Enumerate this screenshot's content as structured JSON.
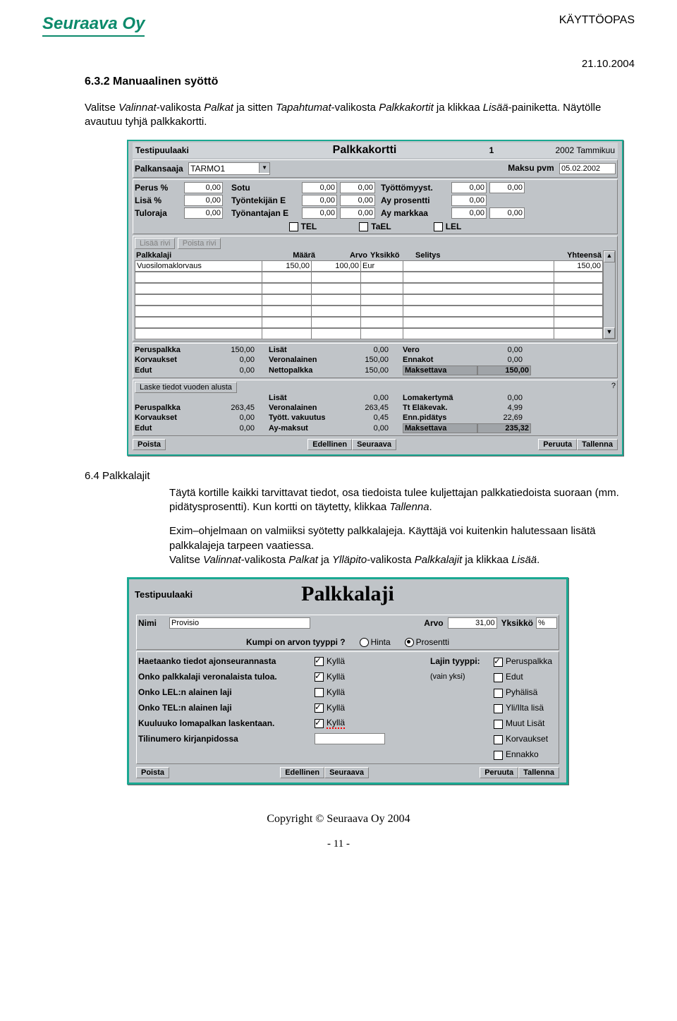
{
  "header": {
    "logo": "Seuraava Oy",
    "doc_type": "KÄYTTÖOPAS",
    "date": "21.10.2004"
  },
  "sec632": {
    "heading": "6.3.2 Manuaalinen syöttö",
    "para": "Valitse Valinnat-valikosta Palkat ja sitten Tapahtumat-valikosta Palkkakortit ja klikkaa Lisää-painiketta. Näytölle avautuu tyhjä palkkakortti."
  },
  "palkkakortti": {
    "company": "Testipuulaaki",
    "title": "Palkkakortti",
    "num": "1",
    "period": "2002 Tammikuu",
    "saaja_lbl": "Palkansaaja",
    "saaja_val": "TARMO1",
    "maksu_lbl": "Maksu pvm",
    "maksu_val": "05.02.2002",
    "top_rows": [
      {
        "l": "Perus %",
        "v1": "0,00",
        "c": "Sotu",
        "v2": "0,00",
        "v3": "0,00",
        "r": "Työttömyyst.",
        "v4": "0,00",
        "v5": "0,00"
      },
      {
        "l": "Lisä %",
        "v1": "0,00",
        "c": "Työntekijän E",
        "v2": "0,00",
        "v3": "0,00",
        "r": "Ay prosentti",
        "v4": "0,00",
        "v5": ""
      },
      {
        "l": "Tuloraja",
        "v1": "0,00",
        "c": "Työnantajan E",
        "v2": "0,00",
        "v3": "0,00",
        "r": "Ay markkaa",
        "v4": "0,00",
        "v5": "0,00"
      }
    ],
    "chk_tel": "TEL",
    "chk_tael": "TaEL",
    "chk_lel": "LEL",
    "btn_lisaa": "Lisää rivi",
    "btn_poista": "Poista rivi",
    "grid_headers": [
      "Palkkalaji",
      "Määrä",
      "Arvo",
      "Yksikkö",
      "Selitys",
      "Yhteensä"
    ],
    "grid_row": {
      "laji": "Vuosilomaklorvaus",
      "maara": "150,00",
      "arvo": "100,00",
      "yks": "Eur",
      "sel": "",
      "yht": "150,00"
    },
    "sum1": [
      [
        "Peruspalkka",
        "150,00",
        "Lisät",
        "0,00",
        "Vero",
        "0,00"
      ],
      [
        "Korvaukset",
        "0,00",
        "Veronalainen",
        "150,00",
        "Ennakot",
        "0,00"
      ],
      [
        "Edut",
        "0,00",
        "Nettopalkka",
        "150,00",
        "Maksettava",
        "150,00"
      ]
    ],
    "btn_laske": "Laske tiedot vuoden alusta",
    "sum2": [
      [
        "",
        "",
        "Lisät",
        "0,00",
        "Lomakertymä",
        "0,00"
      ],
      [
        "Peruspalkka",
        "263,45",
        "Veronalainen",
        "263,45",
        "Tt Eläkevak.",
        "4,99"
      ],
      [
        "Korvaukset",
        "0,00",
        "Tyött. vakuutus",
        "0,45",
        "Enn.pidätys",
        "22,69"
      ],
      [
        "Edut",
        "0,00",
        "Ay-maksut",
        "0,00",
        "Maksettava",
        "235,32"
      ]
    ],
    "btn_bottom": {
      "poista": "Poista",
      "edell": "Edellinen",
      "seur": "Seuraava",
      "peruuta": "Peruuta",
      "tall": "Tallenna"
    }
  },
  "sec64_label": "6.4 Palkkalajit",
  "sec64_para1": "Täytä kortille kaikki tarvittavat tiedot, osa tiedoista tulee kuljettajan palkkatiedoista suoraan (mm. pidätysprosentti). Kun kortti on täytetty, klikkaa Tallenna.",
  "sec64_para2": "Exim–ohjelmaan on valmiiksi syötetty palkkalajeja. Käyttäjä voi kuitenkin halutessaan lisätä palkkalajeja tarpeen vaatiessa.\nValitse Valinnat-valikosta Palkat ja Ylläpito-valikosta Palkkalajit ja klikkaa Lisää.",
  "palkkalaji": {
    "company": "Testipuulaaki",
    "title": "Palkkalaji",
    "nimi_lbl": "Nimi",
    "nimi_val": "Provisio",
    "arvo_lbl": "Arvo",
    "arvo_val": "31,00",
    "yks_lbl": "Yksikkö",
    "yks_val": "%",
    "q": "Kumpi on arvon tyyppi ?",
    "hinta": "Hinta",
    "pros": "Prosentti",
    "left_q": [
      "Haetaanko tiedot ajonseurannasta",
      "Onko palkkalaji veronalaista tuloa.",
      "Onko LEL:n alainen laji",
      "Onko TEL:n alainen laji",
      "Kuuluuko lomapalkan laskentaan.",
      "Tilinumero kirjanpidossa"
    ],
    "kylla": "Kyllä",
    "left_states": [
      true,
      true,
      false,
      true,
      true
    ],
    "right_hdr": "Lajin tyyppi:",
    "right_sub": "(vain yksi)",
    "right_opts": [
      "Peruspalkka",
      "Edut",
      "Pyhälisä",
      "Yli/Ilta lisä",
      "Muut Lisät",
      "Korvaukset",
      "Ennakko"
    ],
    "right_states": [
      true,
      false,
      false,
      false,
      false,
      false,
      false
    ],
    "btn": {
      "poista": "Poista",
      "edell": "Edellinen",
      "seur": "Seuraava",
      "peruuta": "Peruuta",
      "tall": "Tallenna"
    }
  },
  "footer": {
    "copy": "Copyright © Seuraava Oy 2004",
    "page": "- 11 -"
  }
}
